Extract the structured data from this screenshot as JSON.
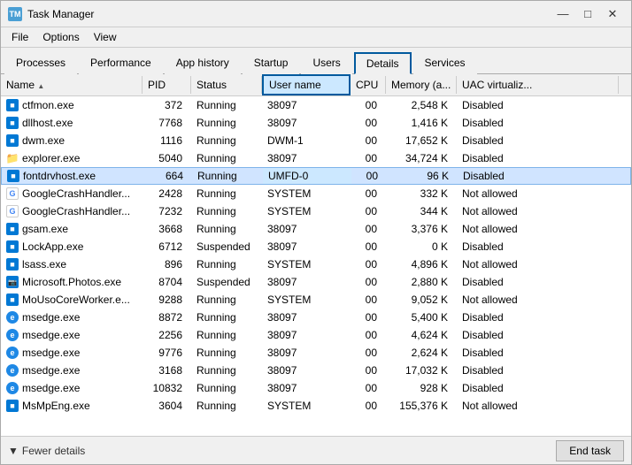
{
  "window": {
    "title": "Task Manager",
    "icon": "TM"
  },
  "menu": {
    "items": [
      "File",
      "Options",
      "View"
    ]
  },
  "tabs": [
    {
      "label": "Processes",
      "active": false
    },
    {
      "label": "Performance",
      "active": false
    },
    {
      "label": "App history",
      "active": false
    },
    {
      "label": "Startup",
      "active": false
    },
    {
      "label": "Users",
      "active": false
    },
    {
      "label": "Details",
      "active": true
    },
    {
      "label": "Services",
      "active": false
    }
  ],
  "table": {
    "columns": [
      {
        "id": "name",
        "label": "Name",
        "sort": "asc"
      },
      {
        "id": "pid",
        "label": "PID"
      },
      {
        "id": "status",
        "label": "Status"
      },
      {
        "id": "username",
        "label": "User name"
      },
      {
        "id": "cpu",
        "label": "CPU"
      },
      {
        "id": "memory",
        "label": "Memory (a..."
      },
      {
        "id": "uac",
        "label": "UAC virtualiz..."
      }
    ],
    "rows": [
      {
        "name": "ctfmon.exe",
        "pid": "372",
        "status": "Running",
        "username": "38097",
        "cpu": "00",
        "memory": "2,548 K",
        "uac": "Disabled",
        "icon": "blue",
        "selected": false
      },
      {
        "name": "dllhost.exe",
        "pid": "7768",
        "status": "Running",
        "username": "38097",
        "cpu": "00",
        "memory": "1,416 K",
        "uac": "Disabled",
        "icon": "blue",
        "selected": false
      },
      {
        "name": "dwm.exe",
        "pid": "1116",
        "status": "Running",
        "username": "DWM-1",
        "cpu": "00",
        "memory": "17,652 K",
        "uac": "Disabled",
        "icon": "blue",
        "selected": false
      },
      {
        "name": "explorer.exe",
        "pid": "5040",
        "status": "Running",
        "username": "38097",
        "cpu": "00",
        "memory": "34,724 K",
        "uac": "Disabled",
        "icon": "folder",
        "selected": false
      },
      {
        "name": "fontdrvhost.exe",
        "pid": "664",
        "status": "Running",
        "username": "UMFD-0",
        "cpu": "00",
        "memory": "96 K",
        "uac": "Disabled",
        "icon": "blue",
        "selected": true
      },
      {
        "name": "GoogleCrashHandler...",
        "pid": "2428",
        "status": "Running",
        "username": "SYSTEM",
        "cpu": "00",
        "memory": "332 K",
        "uac": "Not allowed",
        "icon": "google",
        "selected": false
      },
      {
        "name": "GoogleCrashHandler...",
        "pid": "7232",
        "status": "Running",
        "username": "SYSTEM",
        "cpu": "00",
        "memory": "344 K",
        "uac": "Not allowed",
        "icon": "google",
        "selected": false
      },
      {
        "name": "gsam.exe",
        "pid": "3668",
        "status": "Running",
        "username": "38097",
        "cpu": "00",
        "memory": "3,376 K",
        "uac": "Not allowed",
        "icon": "blue",
        "selected": false
      },
      {
        "name": "LockApp.exe",
        "pid": "6712",
        "status": "Suspended",
        "username": "38097",
        "cpu": "00",
        "memory": "0 K",
        "uac": "Disabled",
        "icon": "blue",
        "selected": false
      },
      {
        "name": "lsass.exe",
        "pid": "896",
        "status": "Running",
        "username": "SYSTEM",
        "cpu": "00",
        "memory": "4,896 K",
        "uac": "Not allowed",
        "icon": "blue",
        "selected": false
      },
      {
        "name": "Microsoft.Photos.exe",
        "pid": "8704",
        "status": "Suspended",
        "username": "38097",
        "cpu": "00",
        "memory": "2,880 K",
        "uac": "Disabled",
        "icon": "photo",
        "selected": false
      },
      {
        "name": "MoUsoCoreWorker.e...",
        "pid": "9288",
        "status": "Running",
        "username": "SYSTEM",
        "cpu": "00",
        "memory": "9,052 K",
        "uac": "Not allowed",
        "icon": "blue",
        "selected": false
      },
      {
        "name": "msedge.exe",
        "pid": "8872",
        "status": "Running",
        "username": "38097",
        "cpu": "00",
        "memory": "5,400 K",
        "uac": "Disabled",
        "icon": "e",
        "selected": false
      },
      {
        "name": "msedge.exe",
        "pid": "2256",
        "status": "Running",
        "username": "38097",
        "cpu": "00",
        "memory": "4,624 K",
        "uac": "Disabled",
        "icon": "e",
        "selected": false
      },
      {
        "name": "msedge.exe",
        "pid": "9776",
        "status": "Running",
        "username": "38097",
        "cpu": "00",
        "memory": "2,624 K",
        "uac": "Disabled",
        "icon": "e",
        "selected": false
      },
      {
        "name": "msedge.exe",
        "pid": "3168",
        "status": "Running",
        "username": "38097",
        "cpu": "00",
        "memory": "17,032 K",
        "uac": "Disabled",
        "icon": "e",
        "selected": false
      },
      {
        "name": "msedge.exe",
        "pid": "10832",
        "status": "Running",
        "username": "38097",
        "cpu": "00",
        "memory": "928 K",
        "uac": "Disabled",
        "icon": "e",
        "selected": false
      },
      {
        "name": "MsMpEng.exe",
        "pid": "3604",
        "status": "Running",
        "username": "SYSTEM",
        "cpu": "00",
        "memory": "155,376 K",
        "uac": "Not allowed",
        "icon": "blue",
        "selected": false
      }
    ]
  },
  "statusBar": {
    "fewerDetailsLabel": "Fewer details",
    "endTaskLabel": "End task"
  },
  "titleControls": {
    "minimize": "—",
    "maximize": "□",
    "close": "✕"
  }
}
